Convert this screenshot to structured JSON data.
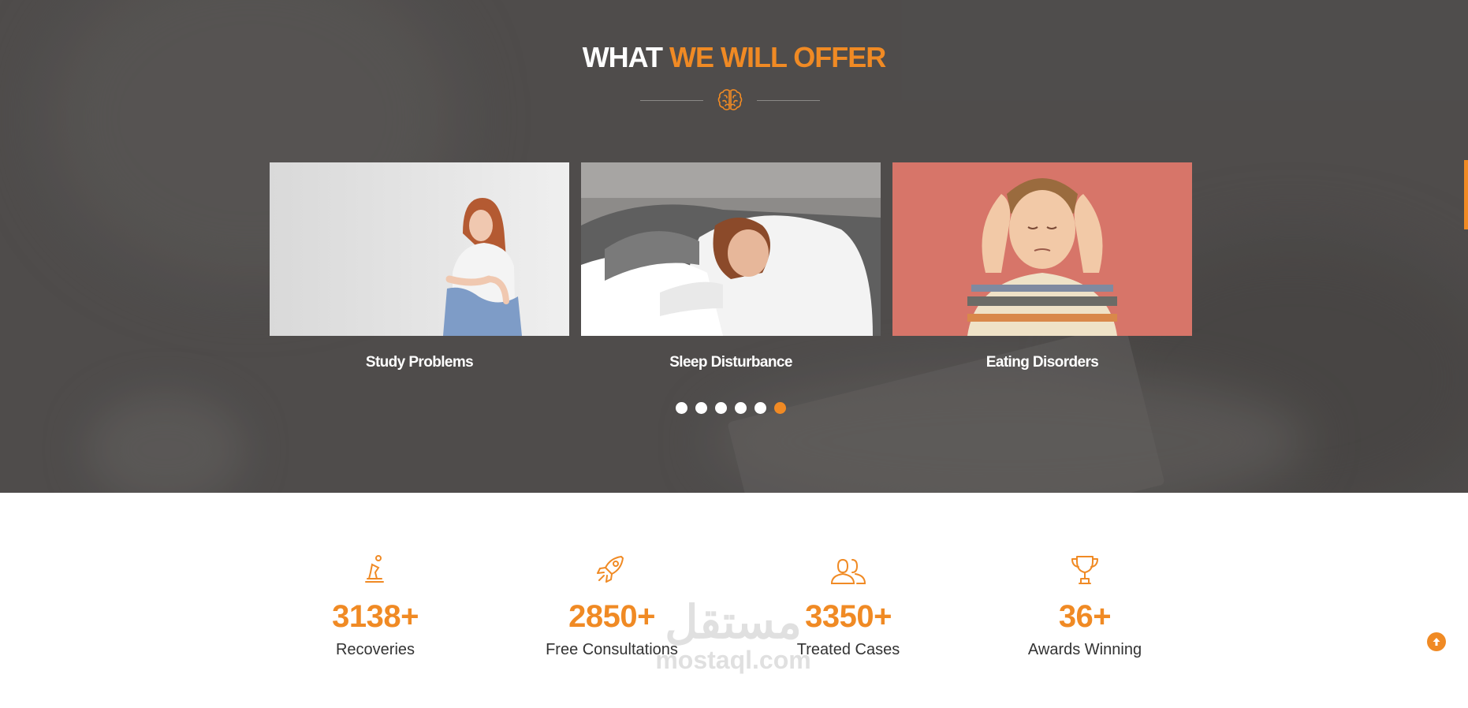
{
  "offer": {
    "title_plain": "WHAT",
    "title_highlight": "WE WILL OFFER",
    "cards": [
      {
        "caption": "Study Problems"
      },
      {
        "caption": "Sleep Disturbance"
      },
      {
        "caption": "Eating Disorders"
      }
    ],
    "carousel": {
      "total": 6,
      "active_index": 5
    }
  },
  "stats": [
    {
      "icon": "chess-piece-icon",
      "value": "3138+",
      "label": "Recoveries"
    },
    {
      "icon": "rocket-icon",
      "value": "2850+",
      "label": "Free Consultations"
    },
    {
      "icon": "users-icon",
      "value": "3350+",
      "label": "Treated Cases"
    },
    {
      "icon": "trophy-icon",
      "value": "36+",
      "label": "Awards Winning"
    }
  ],
  "watermark": {
    "arabic": "مستقل",
    "latin": "mostaql.com"
  },
  "colors": {
    "accent": "#f08a24",
    "hero_bg": "#535150",
    "text_dark": "#333333"
  }
}
